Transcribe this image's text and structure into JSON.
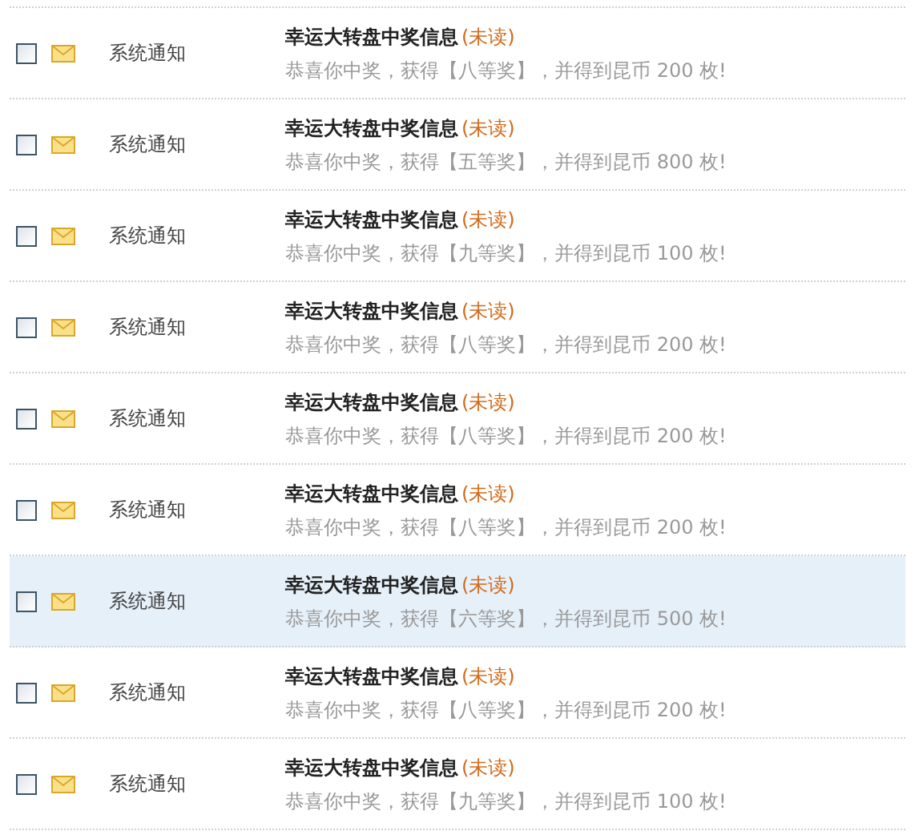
{
  "messages": [
    {
      "checked": false,
      "highlighted": false,
      "sender": "系统通知",
      "title": "幸运大转盘中奖信息",
      "status": "(未读)",
      "body": "恭喜你中奖，获得【八等奖】，并得到昆币 200 枚!"
    },
    {
      "checked": false,
      "highlighted": false,
      "sender": "系统通知",
      "title": "幸运大转盘中奖信息",
      "status": "(未读)",
      "body": "恭喜你中奖，获得【五等奖】，并得到昆币 800 枚!"
    },
    {
      "checked": false,
      "highlighted": false,
      "sender": "系统通知",
      "title": "幸运大转盘中奖信息",
      "status": "(未读)",
      "body": "恭喜你中奖，获得【九等奖】，并得到昆币 100 枚!"
    },
    {
      "checked": false,
      "highlighted": false,
      "sender": "系统通知",
      "title": "幸运大转盘中奖信息",
      "status": "(未读)",
      "body": "恭喜你中奖，获得【八等奖】，并得到昆币 200 枚!"
    },
    {
      "checked": false,
      "highlighted": false,
      "sender": "系统通知",
      "title": "幸运大转盘中奖信息",
      "status": "(未读)",
      "body": "恭喜你中奖，获得【八等奖】，并得到昆币 200 枚!"
    },
    {
      "checked": false,
      "highlighted": false,
      "sender": "系统通知",
      "title": "幸运大转盘中奖信息",
      "status": "(未读)",
      "body": "恭喜你中奖，获得【八等奖】，并得到昆币 200 枚!"
    },
    {
      "checked": false,
      "highlighted": true,
      "sender": "系统通知",
      "title": "幸运大转盘中奖信息",
      "status": "(未读)",
      "body": "恭喜你中奖，获得【六等奖】，并得到昆币 500 枚!"
    },
    {
      "checked": false,
      "highlighted": false,
      "sender": "系统通知",
      "title": "幸运大转盘中奖信息",
      "status": "(未读)",
      "body": "恭喜你中奖，获得【八等奖】，并得到昆币 200 枚!"
    },
    {
      "checked": false,
      "highlighted": false,
      "sender": "系统通知",
      "title": "幸运大转盘中奖信息",
      "status": "(未读)",
      "body": "恭喜你中奖，获得【九等奖】，并得到昆币 100 枚!"
    }
  ]
}
